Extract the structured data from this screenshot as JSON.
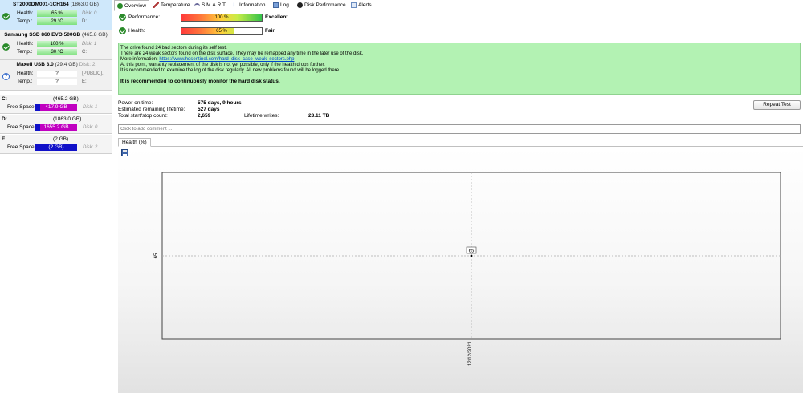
{
  "disks": [
    {
      "name": "ST2000DM001-1CH164",
      "capacity": "(1863.0 GB)",
      "extra": "",
      "status": "ok",
      "health_label": "Health:",
      "health_value": "65 %",
      "health_pct": 65,
      "health_color": "#7ee07e",
      "disk_index": "Disk: 0",
      "temp_label": "Temp.:",
      "temp_value": "29 °C",
      "temp_color": "#7ee07e",
      "letters": "D:"
    },
    {
      "name": "Samsung SSD 860 EVO 500GB",
      "capacity": "(465.8 GB)",
      "extra": "",
      "status": "ok",
      "health_label": "Health:",
      "health_value": "100 %",
      "health_pct": 100,
      "health_color": "#7ee07e",
      "disk_index": "Disk: 1",
      "temp_label": "Temp.:",
      "temp_value": "30 °C",
      "temp_color": "#7ee07e",
      "letters": "C:"
    },
    {
      "name": "Maxell USB 3.0",
      "capacity": "(29.4 GB)",
      "extra": "Disk: 2",
      "status": "unknown",
      "health_label": "Health:",
      "health_value": "?",
      "health_pct": null,
      "health_color": "#ffffff",
      "disk_index": "[PUBLIC],",
      "temp_label": "Temp.:",
      "temp_value": "?",
      "temp_color": "#ffffff",
      "letters": "E:"
    }
  ],
  "partitions": [
    {
      "letter": "C:",
      "size": "(465.2 GB)",
      "free_label": "Free Space",
      "free_value": "417.9 GB",
      "bar_color": "#c000c0",
      "disk": "Disk: 1"
    },
    {
      "letter": "D:",
      "size": "(1863.0 GB)",
      "free_label": "Free Space",
      "free_value": "1655.2 GB",
      "bar_color": "#c000c0",
      "disk": "Disk: 0"
    },
    {
      "letter": "E:",
      "size": "(? GB)",
      "free_label": "Free Space",
      "free_value": "(? GB)",
      "bar_color": "#1010c8",
      "disk": "Disk: 2"
    }
  ],
  "tabs": [
    {
      "label": "Overview",
      "icon": "check-icon",
      "active": true
    },
    {
      "label": "Temperature",
      "icon": "thermometer-icon",
      "active": false
    },
    {
      "label": "S.M.A.R.T.",
      "icon": "smart-icon",
      "active": false
    },
    {
      "label": "Information",
      "icon": "info-icon",
      "active": false
    },
    {
      "label": "Log",
      "icon": "log-icon",
      "active": false
    },
    {
      "label": "Disk Performance",
      "icon": "disk-performance-icon",
      "active": false
    },
    {
      "label": "Alerts",
      "icon": "alerts-icon",
      "active": false
    }
  ],
  "overview": {
    "performance_label": "Performance:",
    "performance_pct": 100,
    "performance_text": "100 %",
    "performance_rating": "Excellent",
    "health_label": "Health:",
    "health_pct": 65,
    "health_text": "65 %",
    "health_rating": "Fair"
  },
  "message": {
    "line1": "The drive found 24 bad sectors during its self test.",
    "line2": "There are 24 weak sectors found on the disk surface. They may be remapped any time in the later use of the disk.",
    "line3_prefix": "More information: ",
    "line3_link": "https://www.hdsentinel.com/hard_disk_case_weak_sectors.php",
    "line4": "At this point, warranty replacement of the disk is not yet possible, only if the health drops further.",
    "line5": "It is recommended to examine the log of the disk regularly. All new problems found will be logged there.",
    "recommendation": "It is recommended to continuously monitor the hard disk status."
  },
  "stats": {
    "power_on_label": "Power on time:",
    "power_on_value": "575 days, 9 hours",
    "lifetime_label": "Estimated remaining lifetime:",
    "lifetime_value": "527 days",
    "startstop_label": "Total start/stop count:",
    "startstop_value": "2,659",
    "writes_label": "Lifetime writes:",
    "writes_value": "23.11 TB"
  },
  "repeat_button": "Repeat Test",
  "comment_placeholder": "Click to add comment ...",
  "health_tab": "Health (%)",
  "chart_data": {
    "type": "line",
    "title": "",
    "xlabel": "",
    "ylabel": "",
    "x": [
      "12/12/2021"
    ],
    "series": [
      {
        "values": [
          65
        ]
      }
    ],
    "y_tick_labels": [
      "65"
    ],
    "x_tick_labels": [
      "12/12/2021"
    ],
    "data_labels": [
      "65"
    ],
    "grid": true,
    "legend": "none"
  }
}
